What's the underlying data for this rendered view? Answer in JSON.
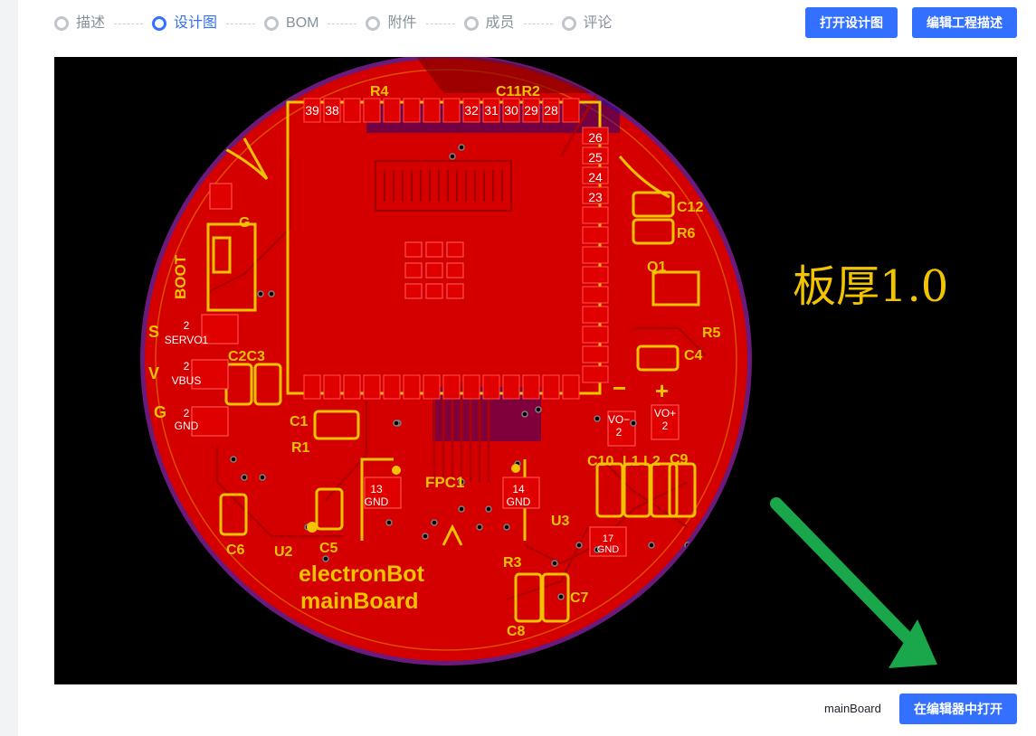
{
  "steps": [
    {
      "label": "描述",
      "active": false
    },
    {
      "label": "设计图",
      "active": true
    },
    {
      "label": "BOM",
      "active": false
    },
    {
      "label": "附件",
      "active": false
    },
    {
      "label": "成员",
      "active": false
    },
    {
      "label": "评论",
      "active": false
    }
  ],
  "header": {
    "open_design_label": "打开设计图",
    "edit_description_label": "编辑工程描述"
  },
  "viewer": {
    "board_thickness_label": "板厚1.0",
    "silkscreen": {
      "r4": "R4",
      "c11r2": "C11R2",
      "c12": "C12",
      "r6": "R6",
      "q1": "Q1",
      "r5": "R5",
      "c4": "C4",
      "boot": "BOOT",
      "g_top": "G",
      "s": "S",
      "v": "V",
      "g": "G",
      "c2c3": "C2C3",
      "c1": "C1",
      "r1": "R1",
      "fpc1": "FPC1",
      "u3": "U3",
      "r3": "R3",
      "c7": "C7",
      "c8": "C8",
      "c6": "C6",
      "u2": "U2",
      "c5": "C5",
      "c10": "C10",
      "l1l2": "L1 L2",
      "c9": "C9",
      "minus": "−",
      "plus": "+",
      "board_line1": "electronBot",
      "board_line2": "mainBoard"
    },
    "pads": {
      "servo1_num": "2",
      "servo1": "SERVO1",
      "vbus_num": "2",
      "vbus": "VBUS",
      "gnd_num": "2",
      "gnd": "GND",
      "fpc13_num": "13",
      "fpc13": "GND",
      "fpc14_num": "14",
      "fpc14": "GND",
      "vo_minus": "VO−",
      "vo_minus_num": "2",
      "vo_plus": "VO+",
      "vo_plus_num": "2",
      "pin26": "26",
      "pin25": "25",
      "pin24": "24",
      "pin23": "23",
      "pin39": "39",
      "pin38": "38",
      "pin32": "32",
      "pin31": "31",
      "pin30": "30",
      "pin29": "29",
      "pin28": "28",
      "u3_pad": "17",
      "u3_pad_net": "GND"
    },
    "colors": {
      "copper": "#d40000",
      "silkscreen": "#f2c300",
      "board_edge": "#6a1a7a",
      "annotation_arrow": "#1aa64a"
    }
  },
  "footer": {
    "board_name": "mainBoard",
    "open_in_editor_label": "在编辑器中打开"
  }
}
